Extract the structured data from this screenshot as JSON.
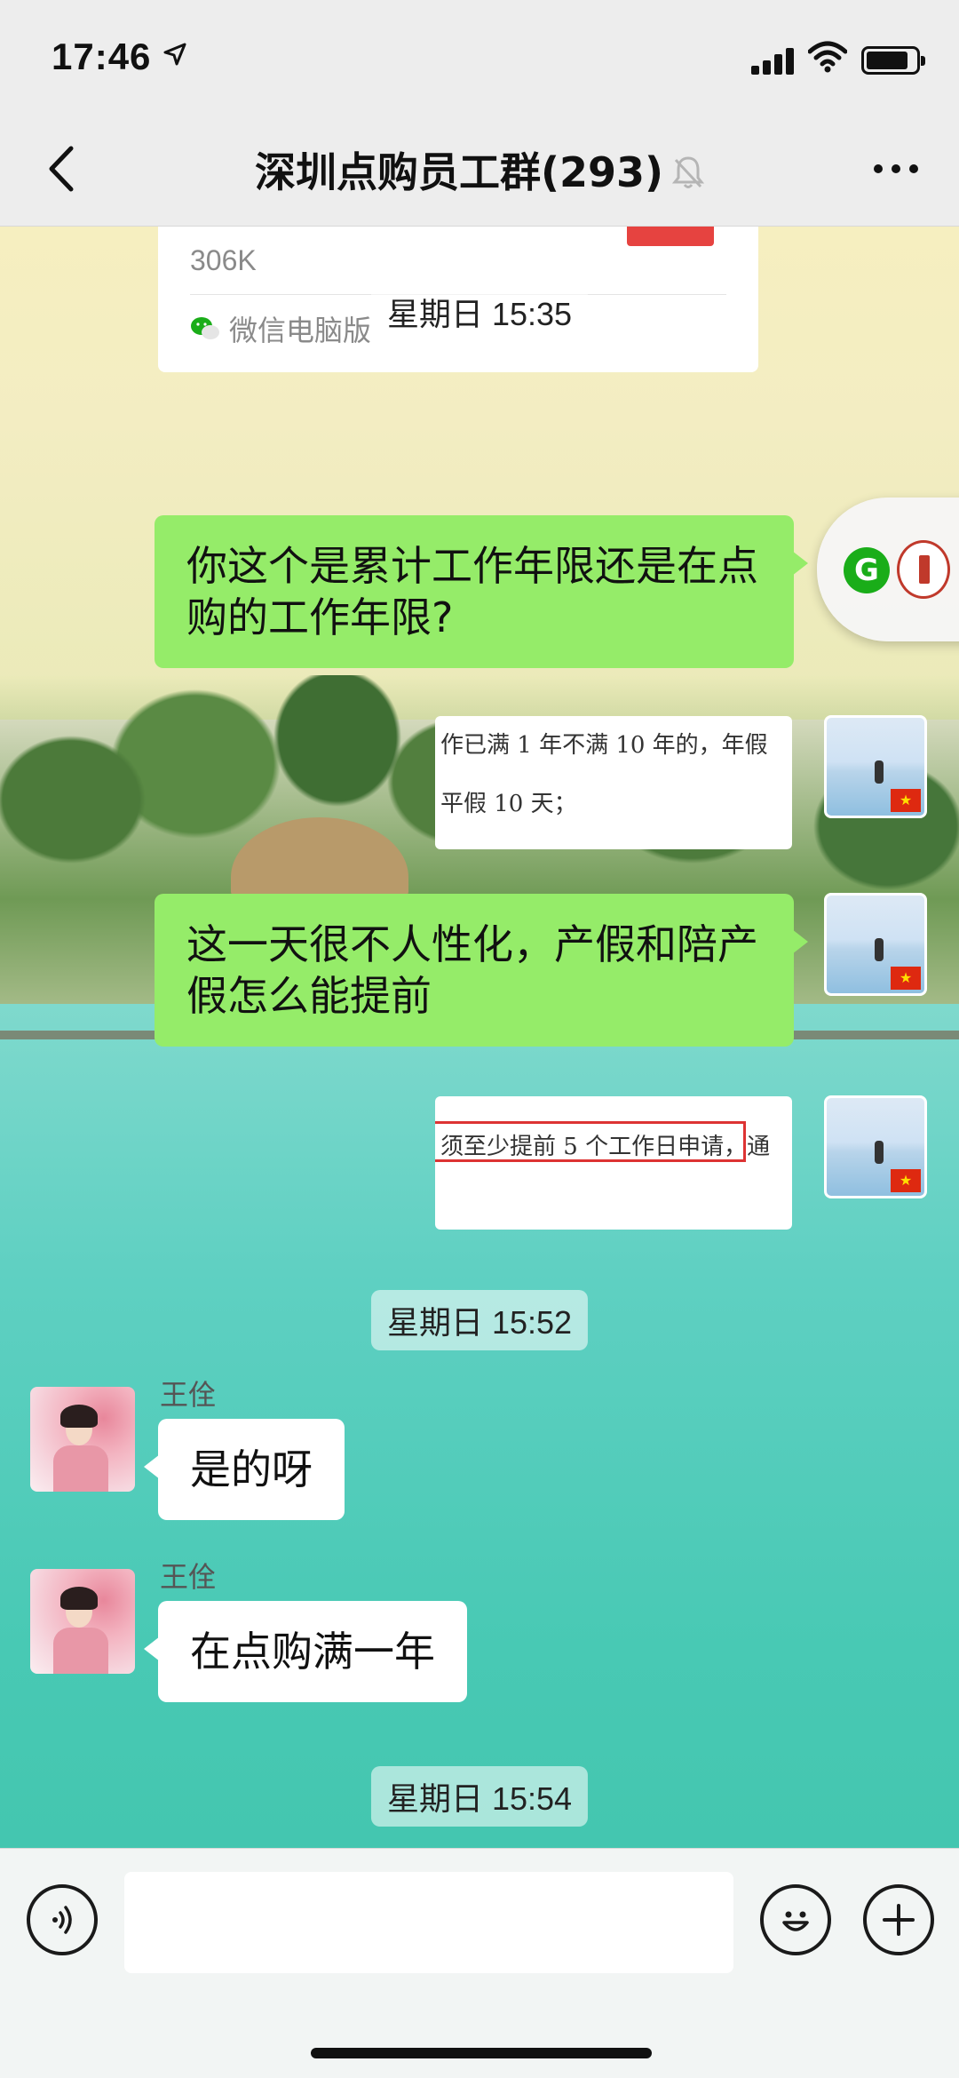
{
  "status_bar": {
    "time": "17:46",
    "location_icon": "arrow-icon"
  },
  "nav": {
    "title": "深圳点购员工群(293)",
    "mute_icon": "bell-slash-icon"
  },
  "file_card": {
    "size": "306K",
    "source": "微信电脑版"
  },
  "messages": {
    "time1": "星期日 15:35",
    "msg1": "你这个是累计工作年限还是在点购的工作年限?",
    "img1_line1": "作已满 1 年不满 10 年的，年假",
    "img1_line2": "平假 10 天；",
    "msg2": "这一天很不人性化，产假和陪产假怎么能提前",
    "img2_line": "须至少提前 5 个工作日申请，通",
    "time2": "星期日 15:52",
    "sender1": "王佺",
    "msg3": "是的呀",
    "sender2": "王佺",
    "msg4": "在点购满一年",
    "time3": "星期日 15:54"
  },
  "input": {
    "placeholder": ""
  },
  "colors": {
    "self_bubble": "#95ec69",
    "other_bubble": "#ffffff",
    "accent": "#1aad19"
  }
}
